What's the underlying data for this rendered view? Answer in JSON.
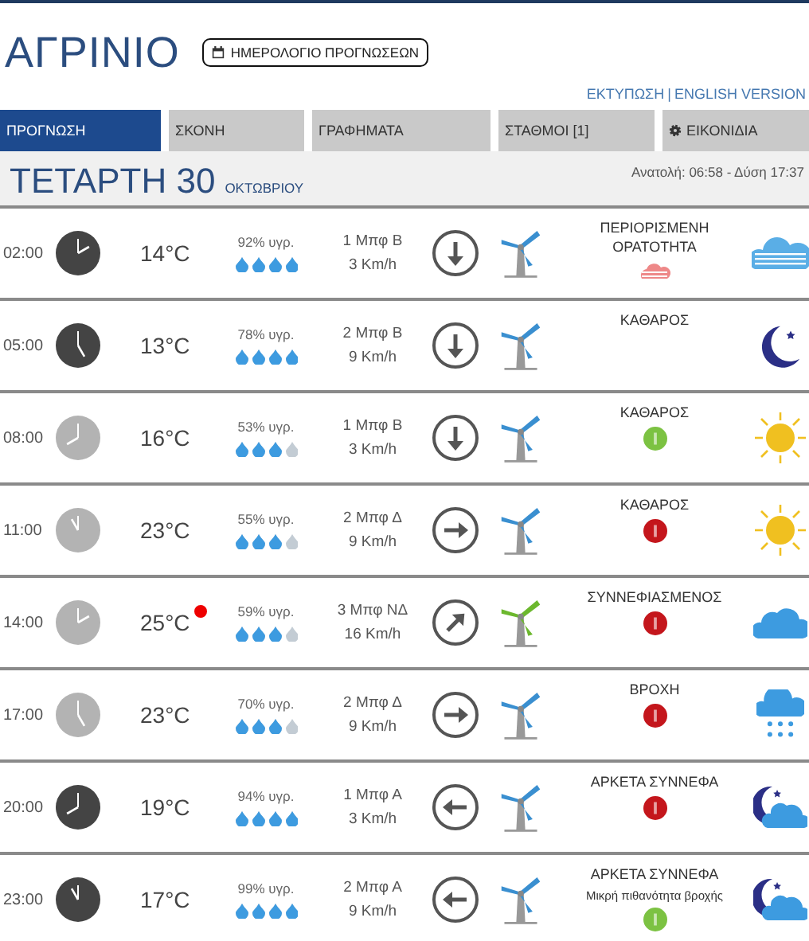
{
  "city": "ΑΓΡΙΝΙΟ",
  "calendar_button": "ΗΜΕΡΟΛΟΓΙΟ ΠΡΟΓΝΩΣΕΩΝ",
  "links": [
    "ΕΚΤΥΠΩΣΗ",
    "ENGLISH VERSION"
  ],
  "links_separator": "|",
  "tabs": [
    {
      "label": "ΠΡΟΓΝΩΣΗ",
      "selected": true
    },
    {
      "label": "ΣΚΟΝΗ",
      "selected": false
    },
    {
      "label": "ΓΡΑΦΗΜΑΤΑ",
      "selected": false
    },
    {
      "label": "ΣΤΑΘΜΟΙ [1]",
      "selected": false
    },
    {
      "label": "ΕΙΚΟΝΙΔΙΑ",
      "selected": false,
      "icon": true
    }
  ],
  "day": {
    "date": "ΤΕΤΑΡΤΗ 30",
    "month": "ΟΚΤΩΒΡΙΟΥ",
    "sun": "Ανατολή: 06:58  - Δύση 17:37"
  },
  "rows": [
    {
      "time": "02:00",
      "night": true,
      "temp": "14°C",
      "humidity": "92% υγρ.",
      "level": 1,
      "beaufort": "1 Μπφ Β",
      "speed": "3 Km/h",
      "arrow": {
        "kind": "down"
      },
      "color": "#3a8fd0",
      "condition": "ΠΕΡΙΟΡΙΣΜΕΝΗ ΟΡΑΤΟΤΗΤΑ",
      "badge": {
        "kind": "haze"
      },
      "sky": {
        "kind": "fog"
      }
    },
    {
      "time": "05:00",
      "night": true,
      "temp": "13°C",
      "humidity": "78% υγρ.",
      "level": 1,
      "beaufort": "2 Μπφ Β",
      "speed": "9 Km/h",
      "arrow": {
        "kind": "down"
      },
      "color": "#3a8fd0",
      "condition": "ΚΑΘΑΡΟΣ",
      "sky": {
        "kind": "moon"
      }
    },
    {
      "time": "08:00",
      "night": false,
      "temp": "16°C",
      "humidity": "53% υγρ.",
      "level": 0.75,
      "beaufort": "1 Μπφ Β",
      "speed": "3 Km/h",
      "arrow": {
        "kind": "down"
      },
      "color": "#3a8fd0",
      "condition": "ΚΑΘΑΡΟΣ",
      "badge": {
        "kind": "ok"
      },
      "sky": {
        "kind": "sun"
      }
    },
    {
      "time": "11:00",
      "night": false,
      "temp": "23°C",
      "humidity": "55% υγρ.",
      "level": 0.75,
      "beaufort": "2 Μπφ Δ",
      "speed": "9 Km/h",
      "arrow": {
        "kind": "right"
      },
      "color": "#3a8fd0",
      "condition": "ΚΑΘΑΡΟΣ",
      "badge": {
        "kind": "alert"
      },
      "sky": {
        "kind": "sun"
      }
    },
    {
      "time": "14:00",
      "night": false,
      "temp": "25°C",
      "hot": true,
      "humidity": "59% υγρ.",
      "level": 0.75,
      "beaufort": "3 Μπφ ΝΔ",
      "speed": "16 Km/h",
      "arrow": {
        "kind": "up-right"
      },
      "color": "#6cb82e",
      "condition": "ΣΥΝΝΕΦΙΑΣΜΕΝΟΣ",
      "badge": {
        "kind": "alert"
      },
      "sky": {
        "kind": "cloud"
      }
    },
    {
      "time": "17:00",
      "night": false,
      "temp": "23°C",
      "humidity": "70% υγρ.",
      "level": 0.75,
      "beaufort": "2 Μπφ Δ",
      "speed": "9 Km/h",
      "arrow": {
        "kind": "right"
      },
      "color": "#3a8fd0",
      "condition": "ΒΡΟΧΗ",
      "badge": {
        "kind": "alert"
      },
      "sky": {
        "kind": "rain"
      }
    },
    {
      "time": "20:00",
      "night": true,
      "temp": "19°C",
      "humidity": "94% υγρ.",
      "level": 1,
      "beaufort": "1 Μπφ Α",
      "speed": "3 Km/h",
      "arrow": {
        "kind": "left"
      },
      "color": "#3a8fd0",
      "condition": "ΑΡΚΕΤΑ ΣΥΝΝΕΦΑ",
      "badge": {
        "kind": "alert"
      },
      "sky": {
        "kind": "night-cloud"
      }
    },
    {
      "time": "23:00",
      "night": true,
      "temp": "17°C",
      "humidity": "99% υγρ.",
      "level": 1,
      "beaufort": "2 Μπφ Α",
      "speed": "9 Km/h",
      "arrow": {
        "kind": "left"
      },
      "color": "#3a8fd0",
      "condition": "ΑΡΚΕΤΑ ΣΥΝΝΕΦΑ",
      "note": "Μικρή πιθανότητα βροχής",
      "badge": {
        "kind": "ok"
      },
      "sky": {
        "kind": "night-cloud"
      }
    }
  ]
}
